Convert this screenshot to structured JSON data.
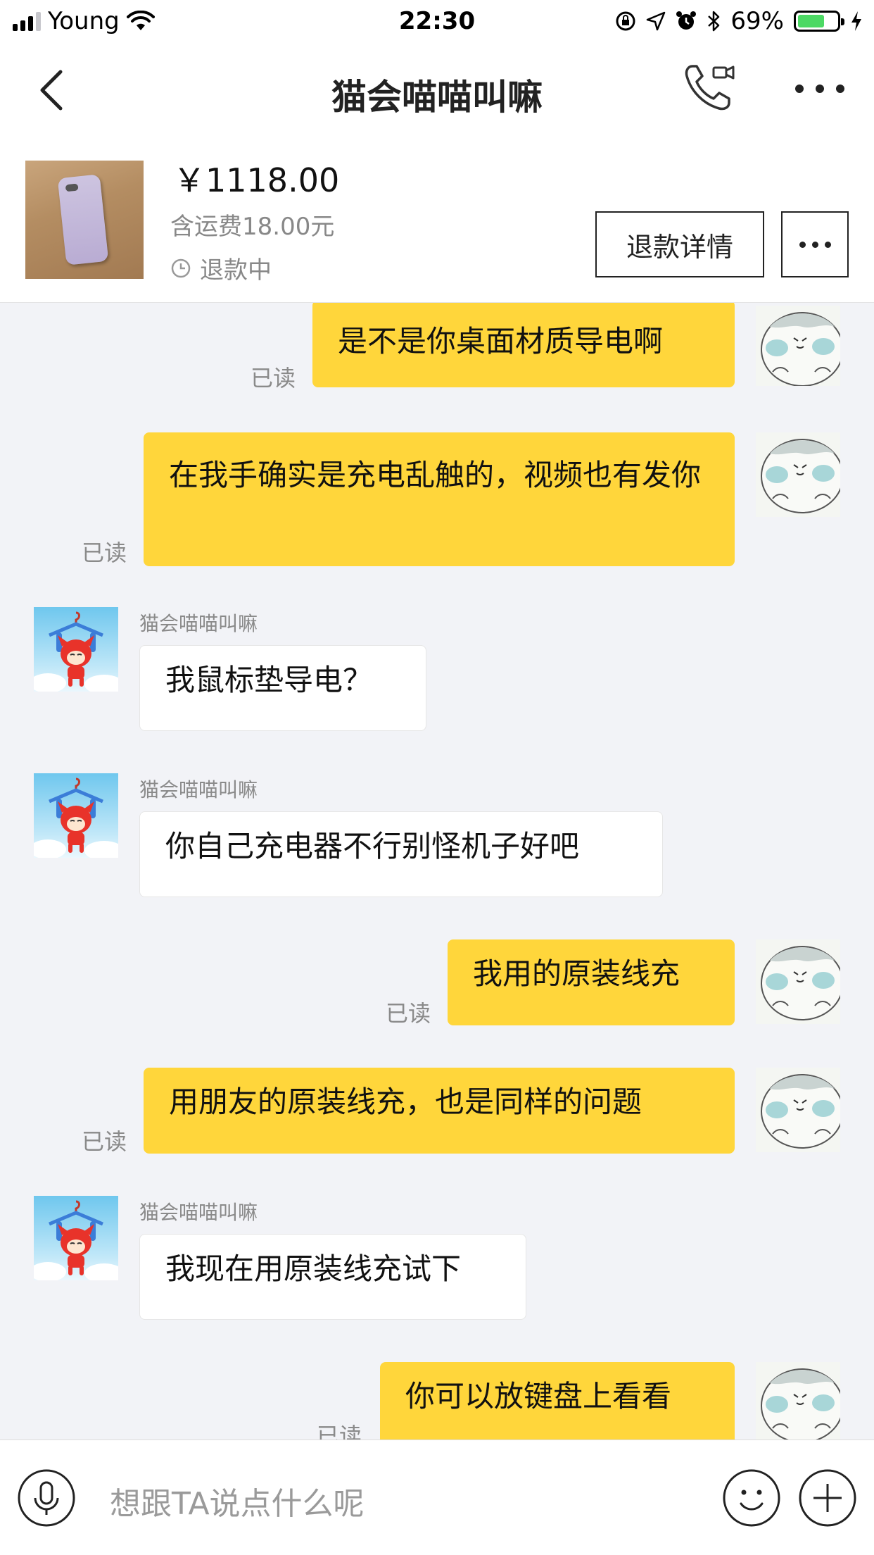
{
  "status_bar": {
    "carrier": "Young",
    "time": "22:30",
    "battery": "69%",
    "battery_level": 0.69,
    "icons": [
      "signal-icon",
      "wifi-icon",
      "rotation-lock-icon",
      "location-icon",
      "alarm-icon",
      "bluetooth-icon",
      "battery-icon",
      "charging-icon"
    ]
  },
  "nav": {
    "title": "猫会喵喵叫嘛",
    "icons": [
      "back-icon",
      "call-icon",
      "more-icon"
    ]
  },
  "product": {
    "price": "￥1118.00",
    "shipping": "含运费18.00元",
    "status": "退款中",
    "refund_button": "退款详情"
  },
  "messages": [
    {
      "from": "me",
      "text": "是不是你桌面材质导电啊",
      "read": "已读"
    },
    {
      "from": "me",
      "text": "在我手确实是充电乱触的，视频也有发你",
      "read": "已读"
    },
    {
      "from": "them",
      "sender": "猫会喵喵叫嘛",
      "text": "我鼠标垫导电？"
    },
    {
      "from": "them",
      "sender": "猫会喵喵叫嘛",
      "text": "你自己充电器不行别怪机子好吧"
    },
    {
      "from": "me",
      "text": "我用的原装线充",
      "read": "已读"
    },
    {
      "from": "me",
      "text": "用朋友的原装线充，也是同样的问题",
      "read": "已读"
    },
    {
      "from": "them",
      "sender": "猫会喵喵叫嘛",
      "text": "我现在用原装线充试下"
    },
    {
      "from": "me",
      "text": "你可以放键盘上看看",
      "read": "已读"
    }
  ],
  "input": {
    "placeholder": "想跟TA说点什么呢",
    "icons": [
      "microphone-icon",
      "emoji-icon",
      "plus-icon"
    ]
  },
  "colors": {
    "my_bubble": "#ffd63b",
    "their_bubble": "#ffffff",
    "chat_background": "#f2f3f7",
    "battery_fill": "#4cd964"
  }
}
